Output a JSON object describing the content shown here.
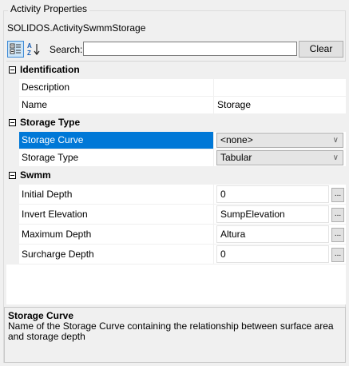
{
  "groupbox": {
    "title": "Activity Properties"
  },
  "object_name": "SOLIDOS.ActivitySwmmStorage",
  "toolbar": {
    "categorized_icon": "categorized-icon",
    "alphabetical_icon": "sort-az-icon",
    "search_label": "Search:",
    "search_value": "",
    "clear_label": "Clear"
  },
  "grid": {
    "categories": [
      {
        "label": "Identification",
        "properties": [
          {
            "name": "Description",
            "value": ""
          },
          {
            "name": "Name",
            "value": "Storage"
          }
        ]
      },
      {
        "label": "Storage Type",
        "properties": [
          {
            "name": "Storage Curve",
            "value": "<none>",
            "editor": "dropdown",
            "selected": true
          },
          {
            "name": "Storage Type",
            "value": "Tabular",
            "editor": "dropdown"
          }
        ]
      },
      {
        "label": "Swmm",
        "properties": [
          {
            "name": "Initial Depth",
            "value": "0",
            "editor": "text-ellipsis"
          },
          {
            "name": "Invert Elevation",
            "value": "SumpElevation",
            "editor": "text-ellipsis"
          },
          {
            "name": "Maximum Depth",
            "value": "Altura",
            "editor": "text-ellipsis"
          },
          {
            "name": "Surcharge Depth",
            "value": "0",
            "editor": "text-ellipsis"
          }
        ]
      }
    ],
    "ellipsis_label": "...",
    "chevron_icon": "chevron-down-icon",
    "selection_color": "#0078d7"
  },
  "help": {
    "title": "Storage Curve",
    "description": "Name of the Storage Curve containing the relationship between surface area and storage depth"
  }
}
